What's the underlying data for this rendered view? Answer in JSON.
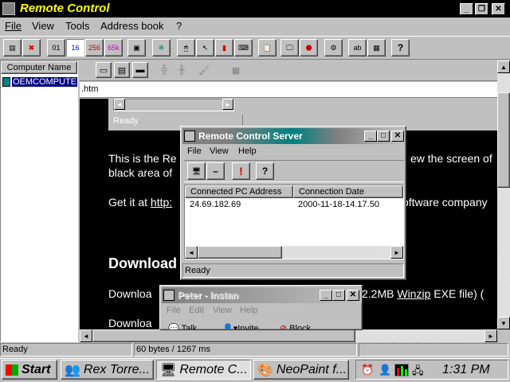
{
  "app": {
    "title": "Remote Control",
    "menu": [
      "File",
      "View",
      "Tools",
      "Address book",
      "?"
    ],
    "color_buttons": [
      "01",
      "16",
      "256",
      "65k"
    ],
    "sidebar_header": "Computer Name",
    "computer": "OEMCOMPUTE",
    "url_fragment": ".htm",
    "status_left": "Ready",
    "status_mid": "60 bytes / 1267 ms"
  },
  "web": {
    "inner_status": "Ready",
    "para1_a": "This is the Re",
    "para1_b": "ew the screen of",
    "para1_c": "black area of",
    "para2_a": "Get it at ",
    "para2_link": "http:",
    "para2_b": "oftware company",
    "heading": "Download",
    "para3_a": "Downloa",
    "para3_b": "2.2MB ",
    "para3_link": "Winzip",
    "para3_c": " EXE file) (",
    "para4": "Downloa"
  },
  "server": {
    "title": "Remote Control Server",
    "menu": [
      "File",
      "View",
      "Help"
    ],
    "columns": [
      "Connected PC Address",
      "Connection Date"
    ],
    "rows": [
      [
        "24.69.182.69",
        "2000-11-18-14.17.50"
      ]
    ],
    "status": "Ready"
  },
  "peter": {
    "title": "Peter - Instan",
    "menu": [
      "File",
      "Edit",
      "View",
      "Help"
    ],
    "tools": [
      "Talk",
      "Invite",
      "Block"
    ]
  },
  "taskbar": {
    "start": "Start",
    "tasks": [
      "Rex Torre...",
      "Remote C...",
      "NeoPaint f..."
    ],
    "clock": "1:31 PM"
  },
  "colors": {
    "title_active": "#000000",
    "title_text": "#ffff00",
    "server_title_grad": "#008080",
    "web_bg": "#000000"
  }
}
